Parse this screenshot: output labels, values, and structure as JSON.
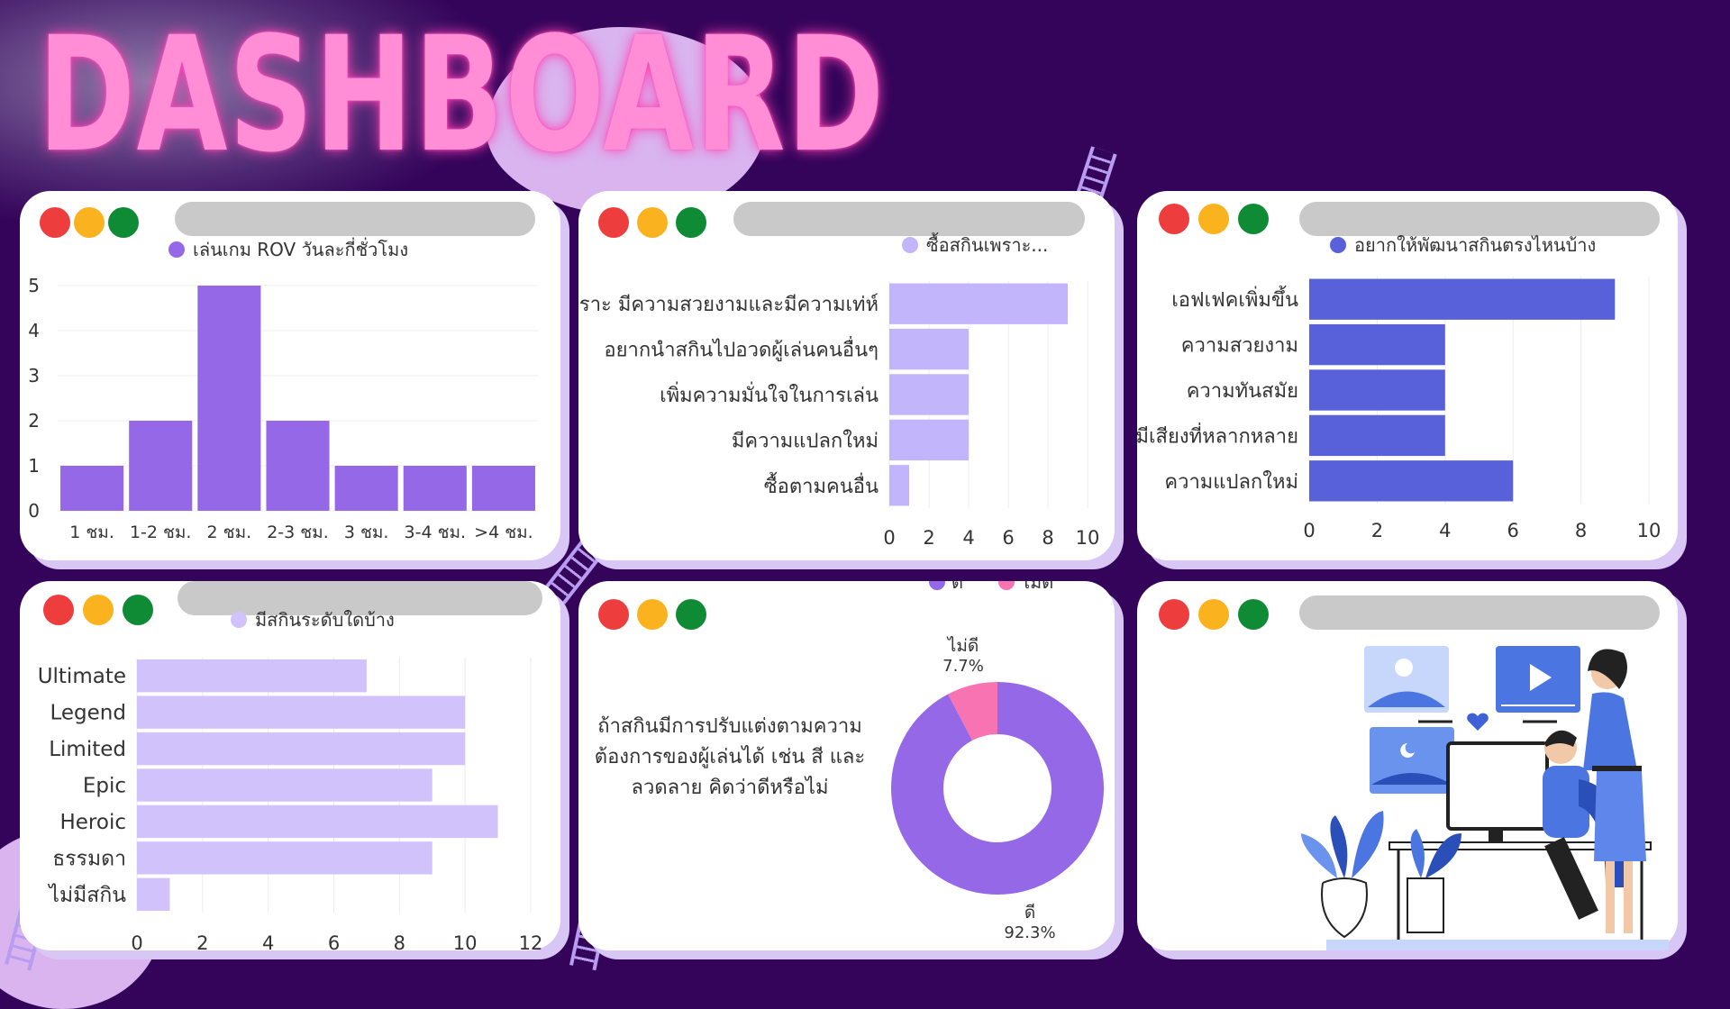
{
  "title": "DASHBOARD",
  "colors": {
    "background": "#34045a",
    "bar_purple": "#9468e6",
    "bar_lavender": "#c3b5fb",
    "bar_blue": "#5961da",
    "skin_lavender": "#d2c2fc",
    "pie_good": "#9468e6",
    "pie_bad": "#f773b1"
  },
  "chart_data": [
    {
      "type": "bar",
      "legend": "เล่นเกม ROV วันละกี่ชั่วโมง",
      "categories": [
        "1 ชม.",
        "1-2 ชม.",
        "2 ชม.",
        "2-3 ชม.",
        "3 ชม.",
        "3-4 ชม.",
        ">4 ชม."
      ],
      "values": [
        1,
        2,
        5,
        2,
        1,
        1,
        1
      ],
      "ylim": [
        0,
        5
      ],
      "yticks": [
        "0",
        "1",
        "2",
        "3",
        "4",
        "5"
      ],
      "grid": true
    },
    {
      "type": "bar",
      "orientation": "horizontal",
      "legend": "ซื้อสกินเพราะ...",
      "categories": [
        "เพราะ มีความสวยงามและมีความเท่ห์",
        "อยากนำสกินไปอวดผู้เล่นคนอื่นๆ",
        "เพิ่มความมั่นใจในการเล่น",
        "มีความแปลกใหม่",
        "ซื้อตามคนอื่น"
      ],
      "values": [
        9,
        4,
        4,
        4,
        1
      ],
      "xlim": [
        0,
        10
      ],
      "xticks": [
        "0",
        "2",
        "4",
        "6",
        "8",
        "10"
      ],
      "grid": true
    },
    {
      "type": "bar",
      "orientation": "horizontal",
      "legend": "อยากให้พัฒนาสกินตรงไหนบ้าง",
      "categories": [
        "เอฟเฟคเพิ่มขึ้น",
        "ความสวยงาม",
        "ความทันสมัย",
        "มีเสียงที่หลากหลาย",
        "ความแปลกใหม่"
      ],
      "values": [
        9,
        4,
        4,
        4,
        6
      ],
      "xlim": [
        0,
        10
      ],
      "xticks": [
        "0",
        "2",
        "4",
        "6",
        "8",
        "10"
      ],
      "grid": true
    },
    {
      "type": "bar",
      "orientation": "horizontal",
      "legend": "มีสกินระดับใดบ้าง",
      "categories": [
        "Ultimate",
        "Legend",
        "Limited",
        "Epic",
        "Heroic",
        "ธรรมดา",
        "ไม่มีสกิน"
      ],
      "values": [
        7,
        10,
        10,
        9,
        11,
        9,
        1
      ],
      "xlim": [
        0,
        12
      ],
      "xticks": [
        "0",
        "2",
        "4",
        "6",
        "8",
        "10",
        "12"
      ],
      "grid": true
    },
    {
      "type": "pie",
      "style": "donut",
      "question": "ถ้าสกินมีการปรับแต่งตามความ ต้องการของผู้เล่นได้ เช่น สี และ ลวดลาย คิดว่าดีหรือไม่",
      "question_lines": [
        "ถ้าสกินมีการปรับแต่งตามความ",
        "ต้องการของผู้เล่นได้  เช่น สี และ",
        "ลวดลาย     คิดว่าดีหรือไม่"
      ],
      "legend": [
        "ดี",
        "ไม่ดี"
      ],
      "slices": [
        {
          "label": "ดี",
          "value": 92.3,
          "pct": "92.3%"
        },
        {
          "label": "ไม่ดี",
          "value": 7.7,
          "pct": "7.7%"
        }
      ]
    }
  ]
}
